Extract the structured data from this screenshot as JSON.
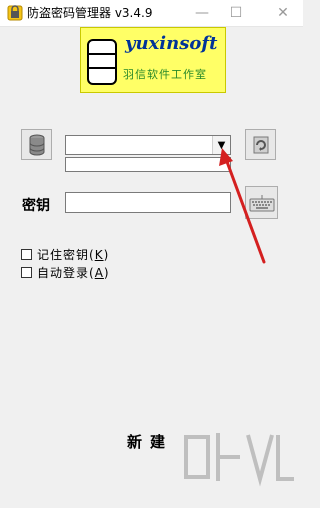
{
  "window": {
    "title": "防盗密码管理器 v3.4.9",
    "minimize_glyph": "—",
    "maximize_glyph": "☐",
    "close_glyph": "✕"
  },
  "logo": {
    "brand": "yuxinsoft",
    "subtitle": "羽信软件工作室"
  },
  "database": {
    "combo_value": "",
    "combo_arrow": "▼",
    "subfield_value": ""
  },
  "key": {
    "label": "密钥",
    "value": ""
  },
  "options": {
    "remember_key_label": "记住密钥(",
    "remember_key_hotkey": "K",
    "remember_key_tail": ")",
    "remember_key_checked": false,
    "auto_login_label": "自动登录(",
    "auto_login_hotkey": "A",
    "auto_login_tail": ")",
    "auto_login_checked": false
  },
  "actions": {
    "new_label": "新建"
  },
  "colors": {
    "logo_bg": "#ffff66",
    "brand_text": "#003399",
    "annotation_arrow": "#d42020"
  },
  "icons": {
    "app": "app-icon",
    "database": "database-icon",
    "refresh": "refresh-icon",
    "keyboard": "keyboard-icon"
  }
}
